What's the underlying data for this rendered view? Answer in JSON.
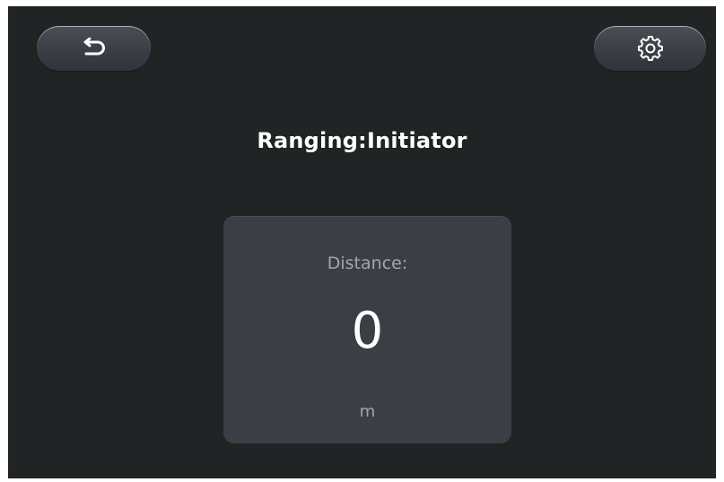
{
  "header": {
    "back_icon": "undo-arrow-icon",
    "settings_icon": "gear-icon"
  },
  "title": "Ranging:Initiator",
  "distance_card": {
    "label": "Distance:",
    "value": "0",
    "unit": "m"
  },
  "colors": {
    "background": "#202425",
    "card": "#3b3e44",
    "button": "#3b3f45",
    "text_primary": "#ffffff",
    "text_secondary": "#a3a6ab"
  }
}
